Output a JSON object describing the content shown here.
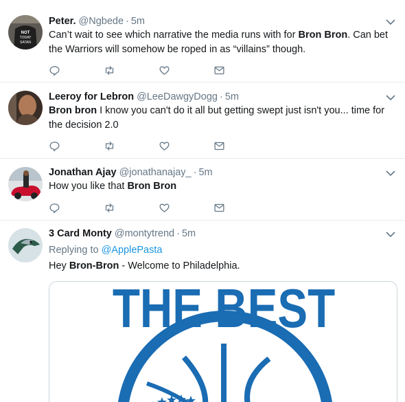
{
  "tweets": [
    {
      "name": "Peter.",
      "handle": "@Ngbede",
      "time": "5m",
      "segments": [
        {
          "t": "Can’t wait to see which narrative the media runs with for ",
          "b": false
        },
        {
          "t": "Bron Bron",
          "b": true
        },
        {
          "t": ". Can bet the Warriors will somehow be roped in as “villains” though.",
          "b": false
        }
      ]
    },
    {
      "name": "Leeroy for Lebron",
      "handle": "@LeeDawgyDogg",
      "time": "5m",
      "segments": [
        {
          "t": "Bron bron",
          "b": true
        },
        {
          "t": " I know you can't do it all but getting swept just isn't you... time for the decision 2.0",
          "b": false
        }
      ]
    },
    {
      "name": "Jonathan Ajay",
      "handle": "@jonathanajay_",
      "time": "5m",
      "segments": [
        {
          "t": "How you like that ",
          "b": false
        },
        {
          "t": "Bron Bron",
          "b": true
        }
      ]
    },
    {
      "name": "3 Card Monty",
      "handle": "@montytrend",
      "time": "5m",
      "replying_label": "Replying to",
      "replying_to": "@ApplePasta",
      "segments": [
        {
          "t": "Hey ",
          "b": false
        },
        {
          "t": "Bron-Bron",
          "b": true
        },
        {
          "t": " - Welcome to Philadelphia.",
          "b": false
        }
      ],
      "media_text": "THE BEST"
    }
  ],
  "avatar_texts": [
    "NOT",
    "TODAY",
    "SATAN"
  ],
  "colors": {
    "name": "#14171a",
    "meta": "#657786",
    "link": "#1b95e0",
    "divider": "#e6ecf0",
    "media_blue": "#1a6cb3"
  },
  "icons": [
    "reply-icon",
    "retweet-icon",
    "like-icon",
    "dm-icon",
    "chevron-down-icon"
  ]
}
